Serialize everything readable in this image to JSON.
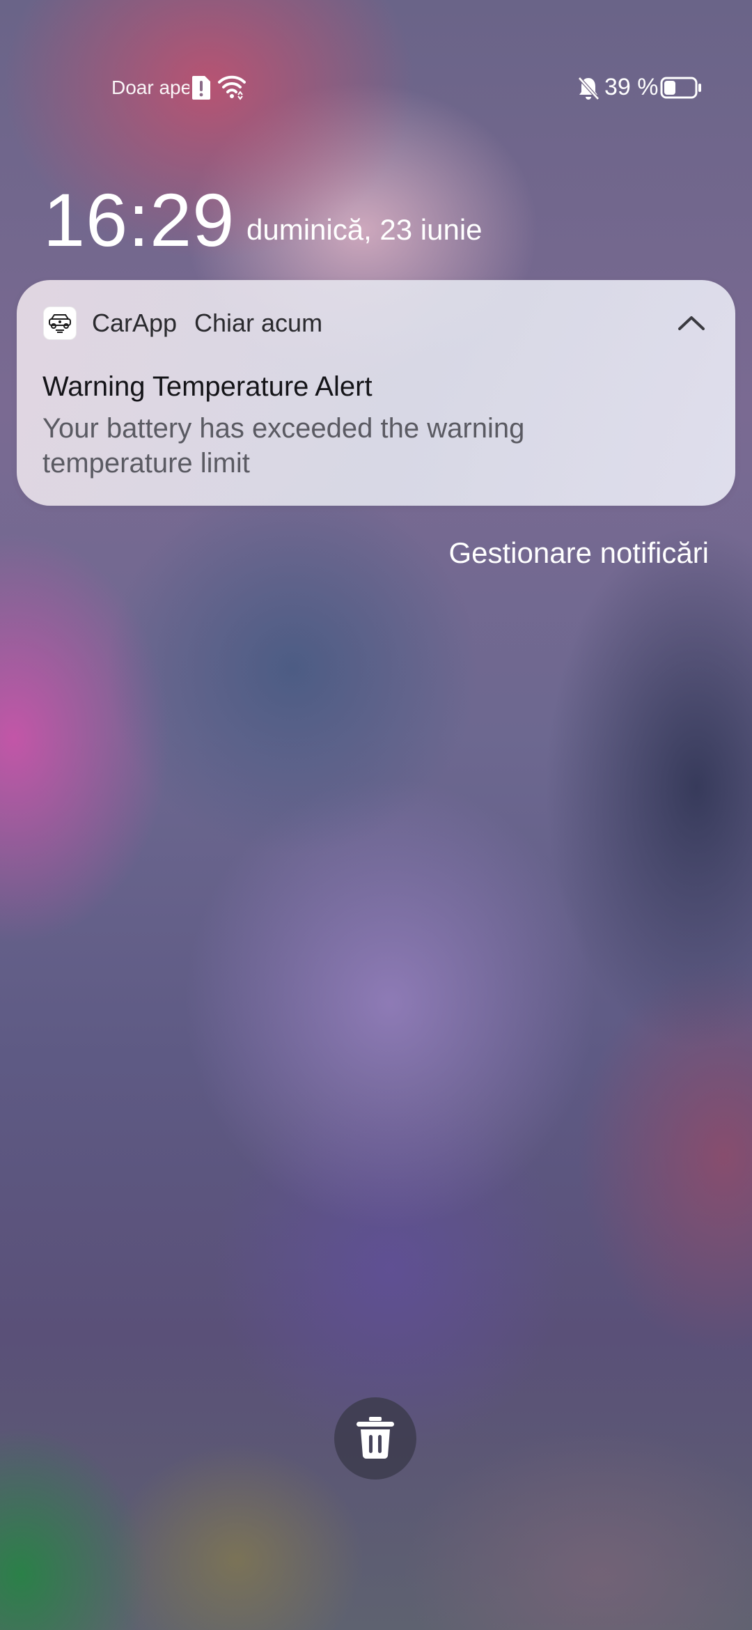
{
  "status_bar": {
    "carrier_text": "Doar apeluri de urgență",
    "battery_percent": "39 %",
    "battery_level": 0.39,
    "icons": [
      "sim-alert-icon",
      "wifi-icon",
      "bell-off-icon",
      "battery-icon"
    ]
  },
  "lockscreen": {
    "time": "16:29",
    "date": "duminică, 23 iunie"
  },
  "notification": {
    "app_icon": "car-app-icon",
    "app_name": "CarApp",
    "time": "Chiar acum",
    "title": "Warning Temperature Alert",
    "body": "Your battery has exceeded the warning temperature limit"
  },
  "manage_notifications_label": "Gestionare notificări",
  "clear_all_icon": "trash-icon"
}
